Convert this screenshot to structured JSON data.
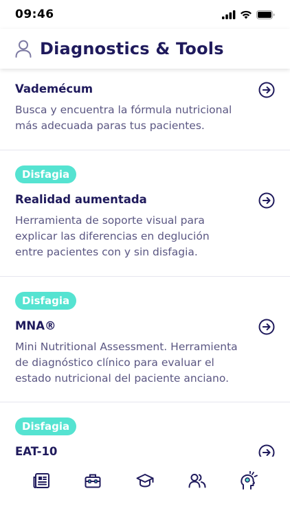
{
  "status": {
    "time": "09:46"
  },
  "header": {
    "title": "Diagnostics & Tools"
  },
  "cards": [
    {
      "title": "Vademécum",
      "description": "Busca y encuentra la fórmula nutricional más adecuada paras tus pacientes."
    },
    {
      "badge": "Disfagia",
      "title": "Realidad aumentada",
      "description": "Herramienta de soporte visual para explicar las diferencias en deglución entre pacientes con y sin disfagia."
    },
    {
      "badge": "Disfagia",
      "title": "MNA®",
      "description": "Mini Nutritional Assessment. Herramienta de diagnóstico clínico para evaluar el estado nutricional del paciente anciano."
    },
    {
      "badge": "Disfagia",
      "title": "EAT-10"
    }
  ],
  "tabs": [
    {
      "icon": "news-icon"
    },
    {
      "icon": "toolbox-icon"
    },
    {
      "icon": "graduation-cap-icon"
    },
    {
      "icon": "users-icon"
    },
    {
      "icon": "head-idea-icon"
    }
  ],
  "colors": {
    "primary": "#1f1a5c",
    "badge": "#55e3d1",
    "description": "#5a5682",
    "divider": "#e6e6ee"
  }
}
